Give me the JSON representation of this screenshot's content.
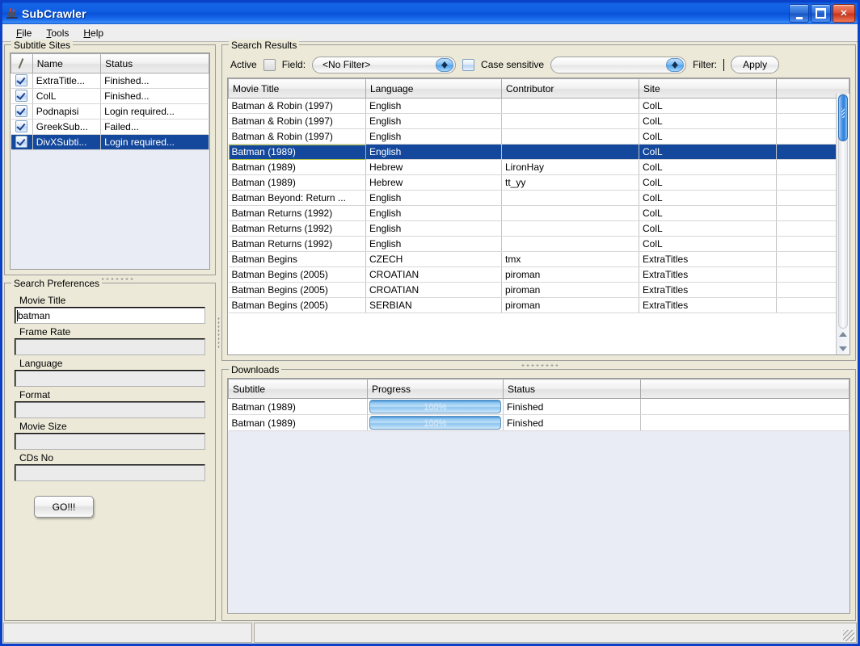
{
  "window": {
    "title": "SubCrawler",
    "icon": "java-coffee-cup-icon",
    "buttons": {
      "minimize": "_",
      "maximize": "▢",
      "close": "✕"
    }
  },
  "menubar": {
    "items": [
      {
        "label": "File",
        "mnemonic": "F"
      },
      {
        "label": "Tools",
        "mnemonic": "T"
      },
      {
        "label": "Help",
        "mnemonic": "H"
      }
    ]
  },
  "subtitle_sites": {
    "title": "Subtitle Sites",
    "columns": [
      "",
      "Name",
      "Status"
    ],
    "rows": [
      {
        "checked": true,
        "name": "ExtraTitle...",
        "status": "Finished...",
        "selected": false
      },
      {
        "checked": true,
        "name": "ColL",
        "status": "Finished...",
        "selected": false
      },
      {
        "checked": true,
        "name": "Podnapisi",
        "status": "Login required...",
        "selected": false
      },
      {
        "checked": true,
        "name": "GreekSub...",
        "status": "Failed...",
        "selected": false
      },
      {
        "checked": true,
        "name": "DivXSubti...",
        "status": "Login required...",
        "selected": true
      }
    ]
  },
  "search_preferences": {
    "title": "Search Preferences",
    "fields": [
      {
        "label": "Movie Title",
        "value": "batman"
      },
      {
        "label": "Frame Rate",
        "value": ""
      },
      {
        "label": "Language",
        "value": ""
      },
      {
        "label": "Format",
        "value": ""
      },
      {
        "label": "Movie Size",
        "value": ""
      },
      {
        "label": "CDs No",
        "value": ""
      }
    ],
    "go_button": "GO!!!"
  },
  "search_results": {
    "title": "Search Results",
    "toolbar": {
      "active_label": "Active",
      "active_checked": false,
      "field_label": "Field:",
      "field_value": "<No Filter>",
      "case_sensitive_label": "Case sensitive",
      "case_sensitive_checked": false,
      "filter_combo_value": "",
      "filter_label": "Filter:",
      "filter_value": "",
      "apply_button": "Apply"
    },
    "columns": [
      "Movie Title",
      "Language",
      "Contributor",
      "Site",
      ""
    ],
    "rows": [
      {
        "title": "Batman & Robin (1997)",
        "language": "English",
        "contributor": "",
        "site": "ColL",
        "extra": "",
        "selected": false
      },
      {
        "title": "Batman & Robin (1997)",
        "language": "English",
        "contributor": "",
        "site": "ColL",
        "extra": "",
        "selected": false
      },
      {
        "title": "Batman & Robin (1997)",
        "language": "English",
        "contributor": "",
        "site": "ColL",
        "extra": "",
        "selected": false
      },
      {
        "title": "Batman (1989)",
        "language": "English",
        "contributor": "",
        "site": "ColL",
        "extra": "",
        "selected": true
      },
      {
        "title": "Batman (1989)",
        "language": "Hebrew",
        "contributor": "LironHay",
        "site": "ColL",
        "extra": "",
        "selected": false
      },
      {
        "title": "Batman (1989)",
        "language": "Hebrew",
        "contributor": "tt_yy",
        "site": "ColL",
        "extra": "",
        "selected": false
      },
      {
        "title": "Batman Beyond: Return ...",
        "language": "English",
        "contributor": "",
        "site": "ColL",
        "extra": "",
        "selected": false
      },
      {
        "title": "Batman Returns (1992)",
        "language": "English",
        "contributor": "",
        "site": "ColL",
        "extra": "",
        "selected": false
      },
      {
        "title": "Batman Returns (1992)",
        "language": "English",
        "contributor": "",
        "site": "ColL",
        "extra": "",
        "selected": false
      },
      {
        "title": "Batman Returns (1992)",
        "language": "English",
        "contributor": "",
        "site": "ColL",
        "extra": "",
        "selected": false
      },
      {
        "title": "Batman Begins",
        "language": "CZECH",
        "contributor": "tmx",
        "site": "ExtraTitles",
        "extra": "",
        "selected": false
      },
      {
        "title": "Batman Begins (2005)",
        "language": "CROATIAN",
        "contributor": "piroman",
        "site": "ExtraTitles",
        "extra": "",
        "selected": false
      },
      {
        "title": "Batman Begins (2005)",
        "language": "CROATIAN",
        "contributor": "piroman",
        "site": "ExtraTitles",
        "extra": "",
        "selected": false
      },
      {
        "title": "Batman Begins (2005)",
        "language": "SERBIAN",
        "contributor": "piroman",
        "site": "ExtraTitles",
        "extra": "",
        "selected": false
      }
    ]
  },
  "downloads": {
    "title": "Downloads",
    "columns": [
      "Subtitle",
      "Progress",
      "Status",
      ""
    ],
    "rows": [
      {
        "subtitle": "Batman (1989)",
        "progress": "100%",
        "progress_pct": 100,
        "status": "Finished",
        "extra": ""
      },
      {
        "subtitle": "Batman (1989)",
        "progress": "100%",
        "progress_pct": 100,
        "status": "Finished",
        "extra": ""
      }
    ]
  },
  "statusbar": {
    "left": "",
    "right": ""
  },
  "colors": {
    "title_blue": "#0a52d8",
    "selection_blue": "#14489c",
    "focus_outline": "#b2c44a",
    "panel_bg": "#ece9d8",
    "empty_list_bg": "#e9ebf5",
    "close_red": "#c8341c"
  }
}
